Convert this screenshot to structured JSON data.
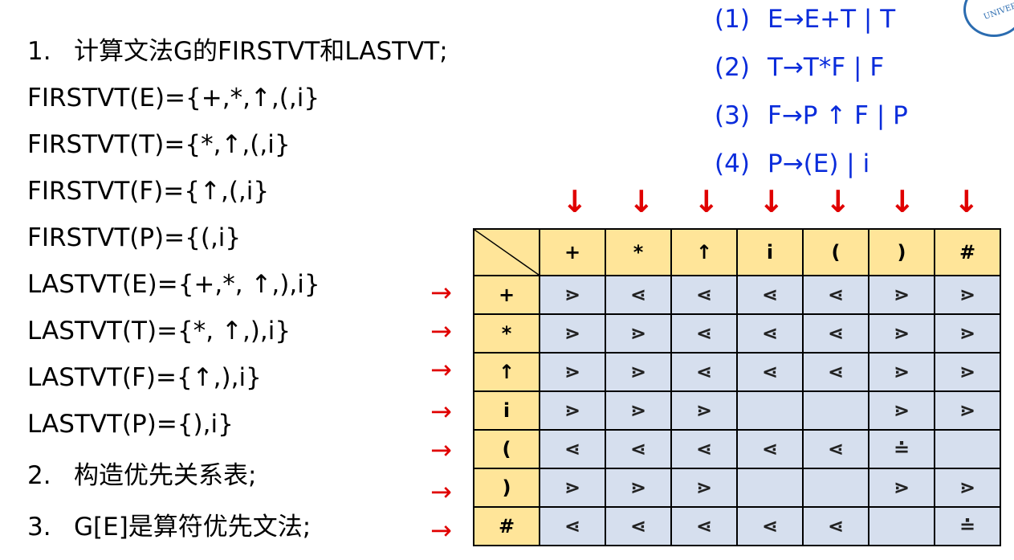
{
  "steps": [
    {
      "num": "1.",
      "text": "计算文法G的FIRSTVT和LASTVT;"
    },
    {
      "num": "2.",
      "text": "构造优先关系表;"
    },
    {
      "num": "3.",
      "text": "G[E]是算符优先文法;"
    }
  ],
  "sets": [
    "FIRSTVT(E)={+,*,↑,(,i}",
    "FIRSTVT(T)={*,↑,(,i}",
    "FIRSTVT(F)={↑,(,i}",
    "FIRSTVT(P)={(,i}",
    "LASTVT(E)={+,*, ↑,),i}",
    "LASTVT(T)={*, ↑,),i}",
    "LASTVT(F)={↑,),i}",
    "LASTVT(P)={),i}"
  ],
  "grammar": [
    {
      "num": "(1)",
      "rule": "E→E+T | T"
    },
    {
      "num": "(2)",
      "rule": "T→T*F | F"
    },
    {
      "num": "(3)",
      "rule": "F→P ↑ F | P"
    },
    {
      "num": "(4)",
      "rule": "P→(E) | i"
    }
  ],
  "table": {
    "columns": [
      "+",
      "*",
      "↑",
      "i",
      "(",
      ")",
      "#"
    ],
    "rows": [
      {
        "head": "+",
        "cells": [
          "⋗",
          "⋖",
          "⋖",
          "⋖",
          "⋖",
          "⋗",
          "⋗"
        ]
      },
      {
        "head": "*",
        "cells": [
          "⋗",
          "⋗",
          "⋖",
          "⋖",
          "⋖",
          "⋗",
          "⋗"
        ]
      },
      {
        "head": "↑",
        "cells": [
          "⋗",
          "⋗",
          "⋖",
          "⋖",
          "⋖",
          "⋗",
          "⋗"
        ]
      },
      {
        "head": "i",
        "cells": [
          "⋗",
          "⋗",
          "⋗",
          "",
          "",
          "⋗",
          "⋗"
        ]
      },
      {
        "head": "(",
        "cells": [
          "⋖",
          "⋖",
          "⋖",
          "⋖",
          "⋖",
          "≐",
          ""
        ]
      },
      {
        "head": ")",
        "cells": [
          "⋗",
          "⋗",
          "⋗",
          "",
          "",
          "⋗",
          "⋗"
        ]
      },
      {
        "head": "#",
        "cells": [
          "⋖",
          "⋖",
          "⋖",
          "⋖",
          "⋖",
          "",
          "≐"
        ]
      }
    ]
  },
  "arrows": {
    "down": "↓",
    "right": "→"
  },
  "colors": {
    "grammar": "#0a2cdb",
    "arrow": "#e00000",
    "header_fill": "#ffe599",
    "cell_fill": "#d6dfee"
  }
}
